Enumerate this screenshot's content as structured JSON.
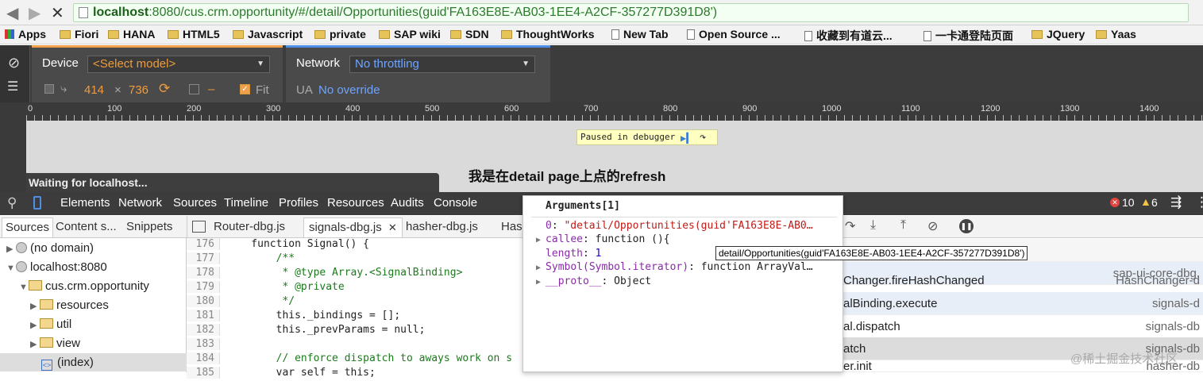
{
  "browser": {
    "url_host": "localhost",
    "url_rest": ":8080/cus.crm.opportunity/#/detail/Opportunities(guid'FA163E8E-AB03-1EE4-A2CF-357277D391D8')"
  },
  "bookmarks": [
    "Apps",
    "Fiori",
    "HANA",
    "HTML5",
    "Javascript",
    "private",
    "SAP wiki",
    "SDN",
    "ThoughtWorks",
    "New Tab",
    "Open Source ...",
    "收藏到有道云...",
    "一卡通登陆页面",
    "JQuery",
    "Yaas"
  ],
  "device_toolbar": {
    "device_label": "Device",
    "device_select": "<Select model>",
    "width": "414",
    "times": "×",
    "height": "736",
    "dash": "–",
    "fit_label": "Fit",
    "network_label": "Network",
    "network_select": "No throttling",
    "ua_label": "UA",
    "ua_value": "No override"
  },
  "ruler_ticks": [
    "0",
    "100",
    "200",
    "300",
    "400",
    "500",
    "600",
    "700",
    "800",
    "900",
    "1000",
    "1100",
    "1200",
    "1300",
    "1400"
  ],
  "page": {
    "paused": "Paused in debugger",
    "headline": "我是在detail page上点的refresh",
    "waiting": "Waiting for localhost..."
  },
  "devtools_tabs": [
    "Elements",
    "Network",
    "Sources",
    "Timeline",
    "Profiles",
    "Resources",
    "Audits",
    "Console"
  ],
  "counts": {
    "errors": "10",
    "warnings": "6"
  },
  "source_subtabs": [
    "Sources",
    "Content s...",
    "Snippets"
  ],
  "file_tabs": [
    "Router-dbg.js",
    "signals-dbg.js",
    "hasher-dbg.js",
    "Has"
  ],
  "tree": [
    {
      "label": "(no domain)"
    },
    {
      "label": "localhost:8080"
    },
    {
      "label": "cus.crm.opportunity"
    },
    {
      "label": "resources"
    },
    {
      "label": "util"
    },
    {
      "label": "view"
    },
    {
      "label": "(index)"
    }
  ],
  "code_lines": [
    {
      "n": "176",
      "text": "    function Signal() {"
    },
    {
      "n": "177",
      "text": "        /**"
    },
    {
      "n": "178",
      "text": "         * @type Array.<SignalBinding>"
    },
    {
      "n": "179",
      "text": "         * @private"
    },
    {
      "n": "180",
      "text": "         */"
    },
    {
      "n": "181",
      "text": "        this._bindings = [];"
    },
    {
      "n": "182",
      "text": "        this._prevParams = null;"
    },
    {
      "n": "183",
      "text": ""
    },
    {
      "n": "184",
      "text": "        // enforce dispatch to aways work on s"
    },
    {
      "n": "185",
      "text": "        var self = this;"
    }
  ],
  "popover": {
    "title": "Arguments[1]",
    "row0_key": "0",
    "row0_val": "\"detail/Opportunities(guid'FA163E8E-AB0…",
    "callee_key": "callee",
    "callee_val": "function (){",
    "length_key": "length",
    "length_val": "1",
    "symbol_key": "Symbol(Symbol.iterator)",
    "symbol_val": "function ArrayVal…",
    "proto_key": "__proto__",
    "proto_val": "Object",
    "tooltip": "detail/Opportunities(guid'FA163E8E-AB03-1EE4-A2CF-357277D391D8')"
  },
  "callstack": [
    {
      "left": "",
      "right": ""
    },
    {
      "left": "",
      "right": "sap-ui-core-dbg."
    },
    {
      "left": "Changer.fireHashChanged",
      "right": "HashChanger-d"
    },
    {
      "left": "alBinding.execute",
      "right": "signals-d"
    },
    {
      "left": "al.dispatch",
      "right": "signals-db"
    },
    {
      "left": "atch",
      "right": "signals-db"
    },
    {
      "left": "er.init",
      "right": "hasher-db"
    }
  ],
  "watermark": "@稀土掘金技术社区"
}
